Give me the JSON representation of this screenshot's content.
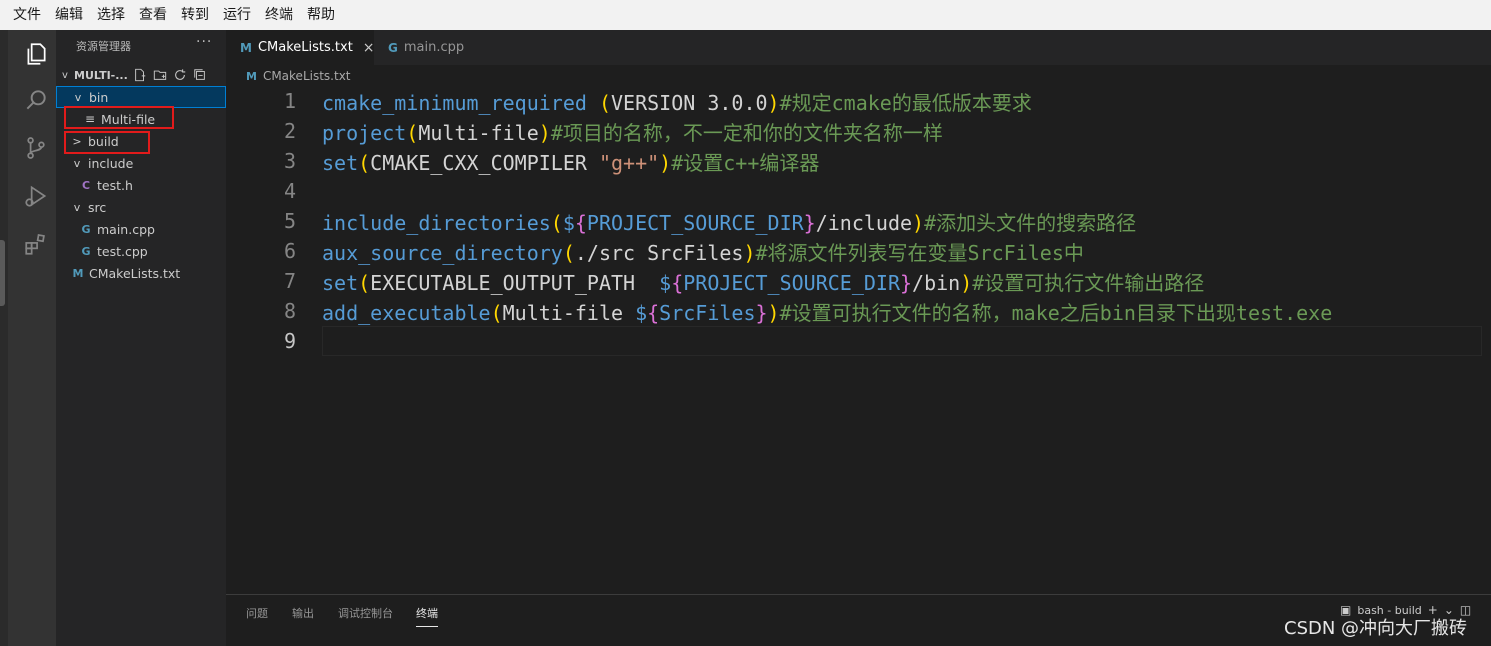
{
  "menu": [
    "文件",
    "编辑",
    "选择",
    "查看",
    "转到",
    "运行",
    "终端",
    "帮助"
  ],
  "sidebar": {
    "title": "资源管理器",
    "more": "···",
    "section": "MULTI-...",
    "tree": [
      {
        "label": "bin",
        "type": "folder",
        "expanded": true,
        "depth": 0,
        "icon": "chevron-down-icon",
        "selected": true
      },
      {
        "label": "Multi-file",
        "type": "file",
        "depth": 1,
        "icon": "lines-file-icon"
      },
      {
        "label": "build",
        "type": "folder",
        "expanded": false,
        "depth": 0,
        "icon": "chevron-right-icon"
      },
      {
        "label": "include",
        "type": "folder",
        "expanded": true,
        "depth": 0,
        "icon": "chevron-down-icon"
      },
      {
        "label": "test.h",
        "type": "file",
        "depth": 1,
        "icon": "c-file-icon"
      },
      {
        "label": "src",
        "type": "folder",
        "expanded": true,
        "depth": 0,
        "icon": "chevron-down-icon"
      },
      {
        "label": "main.cpp",
        "type": "file",
        "depth": 1,
        "icon": "cpp-file-icon"
      },
      {
        "label": "test.cpp",
        "type": "file",
        "depth": 1,
        "icon": "cpp-file-icon"
      },
      {
        "label": "CMakeLists.txt",
        "type": "file",
        "depth": 0,
        "icon": "cmake-file-icon"
      }
    ]
  },
  "icons": {
    "c": "C",
    "cpp": "G",
    "cmake": "M",
    "lines": "≡",
    "chev_down": "v",
    "chev_right": ">"
  },
  "tabs": [
    {
      "label": "CMakeLists.txt",
      "active": true,
      "close": "×"
    },
    {
      "label": "main.cpp",
      "active": false
    }
  ],
  "breadcrumb": "CMakeLists.txt",
  "code": {
    "line_numbers": [
      "1",
      "2",
      "3",
      "4",
      "5",
      "6",
      "7",
      "8",
      "9"
    ],
    "current_line": 9,
    "lines": [
      "cmake_minimum_required (VERSION 3.0.0)#规定cmake的最低版本要求",
      "project(Multi-file)#项目的名称，不一定和你的文件夹名称一样",
      "set(CMAKE_CXX_COMPILER \"g++\")#设置c++编译器",
      "",
      "include_directories(${PROJECT_SOURCE_DIR}/include)#添加头文件的搜索路径",
      "aux_source_directory(./src SrcFiles)#将源文件列表写在变量SrcFiles中",
      "set(EXECUTABLE_OUTPUT_PATH  ${PROJECT_SOURCE_DIR}/bin)#设置可执行文件输出路径",
      "add_executable(Multi-file ${SrcFiles})#设置可执行文件的名称，make之后bin目录下出现test.exe",
      ""
    ]
  },
  "panel": {
    "tabs": [
      "问题",
      "输出",
      "调试控制台",
      "终端"
    ],
    "active_tab": "终端",
    "terminal_label": "bash - build",
    "plus": "+",
    "chevron": "⌄"
  },
  "watermark": "CSDN @冲向大厂搬砖",
  "colors": {
    "keyword": "#569cd6",
    "comment": "#6a9955",
    "string": "#ce9178",
    "variable": "#9cdcfe",
    "bracket1": "#ffd700",
    "bracket2": "#da70d6",
    "highlight_box": "#e21b1b"
  }
}
